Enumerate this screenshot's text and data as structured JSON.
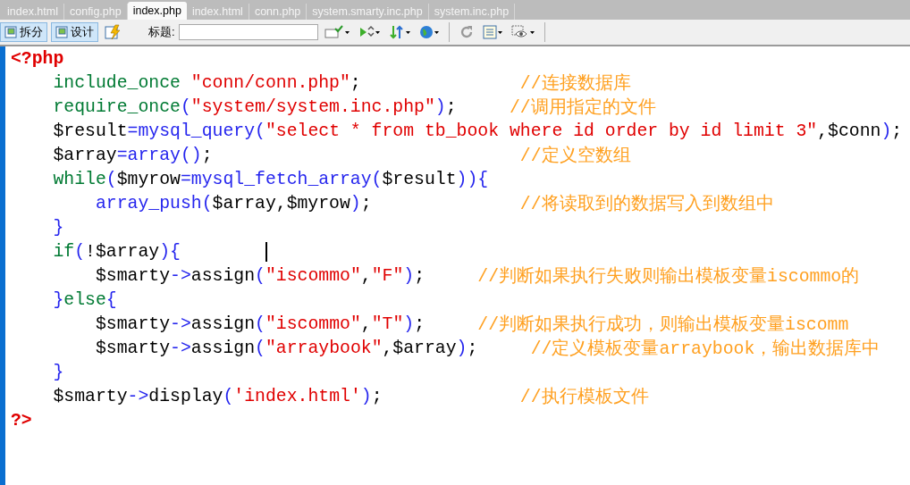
{
  "tabs": [
    {
      "label": "index.html",
      "selected": false
    },
    {
      "label": "config.php",
      "selected": false
    },
    {
      "label": "index.php",
      "selected": true
    },
    {
      "label": "index.html",
      "selected": false
    },
    {
      "label": "conn.php",
      "selected": false
    },
    {
      "label": "system.smarty.inc.php",
      "selected": false
    },
    {
      "label": "system.inc.php",
      "selected": false
    }
  ],
  "toolbar": {
    "view_buttons": [
      {
        "label": "拆分",
        "selected": true
      },
      {
        "label": "设计",
        "selected": true
      }
    ],
    "title_label": "标题:"
  },
  "code_lines": [
    {
      "tokens": [
        {
          "kind": "tag",
          "text": "<?php"
        }
      ],
      "children": [
        {
          "tokens": [
            {
              "kind": "keyword",
              "text": "include_once"
            },
            {
              "kind": "string",
              "text": " \"conn/conn.php\""
            },
            {
              "kind": "plain",
              "text": ";"
            }
          ],
          "comment": "//连接数据库"
        },
        {
          "tokens": [
            {
              "kind": "keyword",
              "text": "require_once"
            },
            {
              "kind": "bracket",
              "text": "("
            },
            {
              "kind": "string",
              "text": "\"system/system.inc.php\""
            },
            {
              "kind": "bracket",
              "text": ")"
            },
            {
              "kind": "plain",
              "text": ";"
            }
          ],
          "comment": "//调用指定的文件"
        },
        {
          "tokens": [
            {
              "kind": "plain",
              "text": "$result"
            },
            {
              "kind": "function",
              "text": "=mysql_query("
            },
            {
              "kind": "string",
              "text": "\"select * from tb_book where id order by id limit 3\""
            },
            {
              "kind": "plain",
              "text": ",$conn"
            },
            {
              "kind": "bracket",
              "text": ")"
            },
            {
              "kind": "plain",
              "text": ";"
            }
          ]
        },
        {
          "tokens": [
            {
              "kind": "plain",
              "text": "$array"
            },
            {
              "kind": "function",
              "text": "=array()"
            },
            {
              "kind": "plain",
              "text": ";"
            }
          ],
          "comment": "//定义空数组"
        },
        {
          "tokens": [
            {
              "kind": "keyword",
              "text": "while"
            },
            {
              "kind": "bracket",
              "text": "("
            },
            {
              "kind": "plain",
              "text": "$myrow"
            },
            {
              "kind": "function",
              "text": "=mysql_fetch_array("
            },
            {
              "kind": "plain",
              "text": "$result"
            },
            {
              "kind": "bracket",
              "text": ")){"
            }
          ],
          "children": [
            {
              "tokens": [
                {
                  "kind": "function",
                  "text": "array_push("
                },
                {
                  "kind": "plain",
                  "text": "$array,$myrow"
                },
                {
                  "kind": "bracket",
                  "text": ")"
                },
                {
                  "kind": "plain",
                  "text": ";"
                }
              ],
              "comment": "//将读取到的数据写入到数组中"
            }
          ]
        },
        {
          "tokens": [
            {
              "kind": "bracket",
              "text": "}"
            }
          ]
        },
        {
          "caret": true,
          "tokens": [
            {
              "kind": "keyword",
              "text": "if"
            },
            {
              "kind": "bracket",
              "text": "("
            },
            {
              "kind": "plain",
              "text": "!$array"
            },
            {
              "kind": "bracket",
              "text": "){"
            }
          ],
          "children": [
            {
              "tokens": [
                {
                  "kind": "plain",
                  "text": "$smarty"
                },
                {
                  "kind": "function",
                  "text": "->"
                },
                {
                  "kind": "plain",
                  "text": "assign"
                },
                {
                  "kind": "bracket",
                  "text": "("
                },
                {
                  "kind": "string",
                  "text": "\"iscommo\""
                },
                {
                  "kind": "plain",
                  "text": ","
                },
                {
                  "kind": "string",
                  "text": "\"F\""
                },
                {
                  "kind": "bracket",
                  "text": ")"
                },
                {
                  "kind": "plain",
                  "text": ";"
                }
              ],
              "comment": "//判断如果执行失败则输出模板变量iscommo的"
            }
          ]
        },
        {
          "tokens": [
            {
              "kind": "bracket",
              "text": "}"
            },
            {
              "kind": "keyword",
              "text": "else"
            },
            {
              "kind": "bracket",
              "text": "{"
            }
          ],
          "children": [
            {
              "tokens": [
                {
                  "kind": "plain",
                  "text": "$smarty"
                },
                {
                  "kind": "function",
                  "text": "->"
                },
                {
                  "kind": "plain",
                  "text": "assign"
                },
                {
                  "kind": "bracket",
                  "text": "("
                },
                {
                  "kind": "string",
                  "text": "\"iscommo\""
                },
                {
                  "kind": "plain",
                  "text": ","
                },
                {
                  "kind": "string",
                  "text": "\"T\""
                },
                {
                  "kind": "bracket",
                  "text": ")"
                },
                {
                  "kind": "plain",
                  "text": ";"
                }
              ],
              "comment": "//判断如果执行成功，则输出模板变量iscomm"
            },
            {
              "tokens": [
                {
                  "kind": "plain",
                  "text": "$smarty"
                },
                {
                  "kind": "function",
                  "text": "->"
                },
                {
                  "kind": "plain",
                  "text": "assign"
                },
                {
                  "kind": "bracket",
                  "text": "("
                },
                {
                  "kind": "string",
                  "text": "\"arraybook\""
                },
                {
                  "kind": "plain",
                  "text": ",$array"
                },
                {
                  "kind": "bracket",
                  "text": ")"
                },
                {
                  "kind": "plain",
                  "text": ";"
                }
              ],
              "comment": "//定义模板变量arraybook，输出数据库中"
            }
          ]
        },
        {
          "tokens": [
            {
              "kind": "bracket",
              "text": "}"
            }
          ]
        },
        {
          "tokens": [
            {
              "kind": "plain",
              "text": "$smarty"
            },
            {
              "kind": "function",
              "text": "->"
            },
            {
              "kind": "plain",
              "text": "display"
            },
            {
              "kind": "bracket",
              "text": "("
            },
            {
              "kind": "string",
              "text": "'index.html'"
            },
            {
              "kind": "bracket",
              "text": ")"
            },
            {
              "kind": "plain",
              "text": ";"
            }
          ],
          "comment": "//执行模板文件"
        }
      ]
    },
    {
      "tokens": [
        {
          "kind": "tag",
          "text": "?>"
        }
      ]
    }
  ]
}
